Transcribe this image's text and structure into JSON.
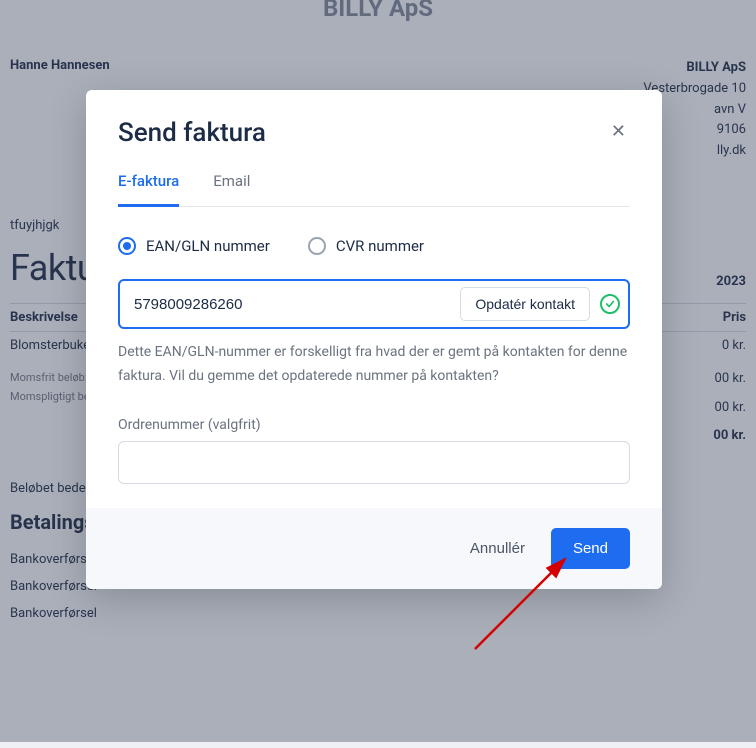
{
  "bg": {
    "company_title": "BILLY ApS",
    "left_name": "Hanne Hannesen",
    "right": {
      "company": "BILLY ApS",
      "addr1": "Vesterbrogade 10",
      "addr2": "avn V",
      "cvr": "9106",
      "domain": "lly.dk"
    },
    "ref": "tfuyjhjgk",
    "faktura_heading": "Faktu",
    "year": "2023",
    "col_desc": "Beskrivelse",
    "col_price": "Pris",
    "row_desc": "Blomsterbuket",
    "kr0": "0 kr.",
    "kr00a": "00 kr.",
    "kr00b": "00 kr.",
    "kr00c": "00 kr.",
    "vat_free": "Momsfrit beløb:",
    "vat_due": "Momspligtigt beløb",
    "payment_note": "Beløbet bedes i",
    "payment_title": "Betalings",
    "bank1": "Bankoverførsel",
    "bank2": "Bankoverførsel",
    "bank3": "Bankoverførsel"
  },
  "modal": {
    "title": "Send faktura",
    "tabs": {
      "efaktura": "E-faktura",
      "email": "Email"
    },
    "radios": {
      "ean": "EAN/GLN nummer",
      "cvr": "CVR nummer"
    },
    "ean_value": "5798009286260",
    "update_contact_label": "Opdatér kontakt",
    "help": "Dette EAN/GLN-nummer er forskelligt fra hvad der er gemt på kontakten for denne faktura. Vil du gemme det opdaterede nummer på kontakten?",
    "order_label": "Ordrenummer (valgfrit)",
    "order_value": "",
    "cancel_label": "Annullér",
    "send_label": "Send"
  }
}
